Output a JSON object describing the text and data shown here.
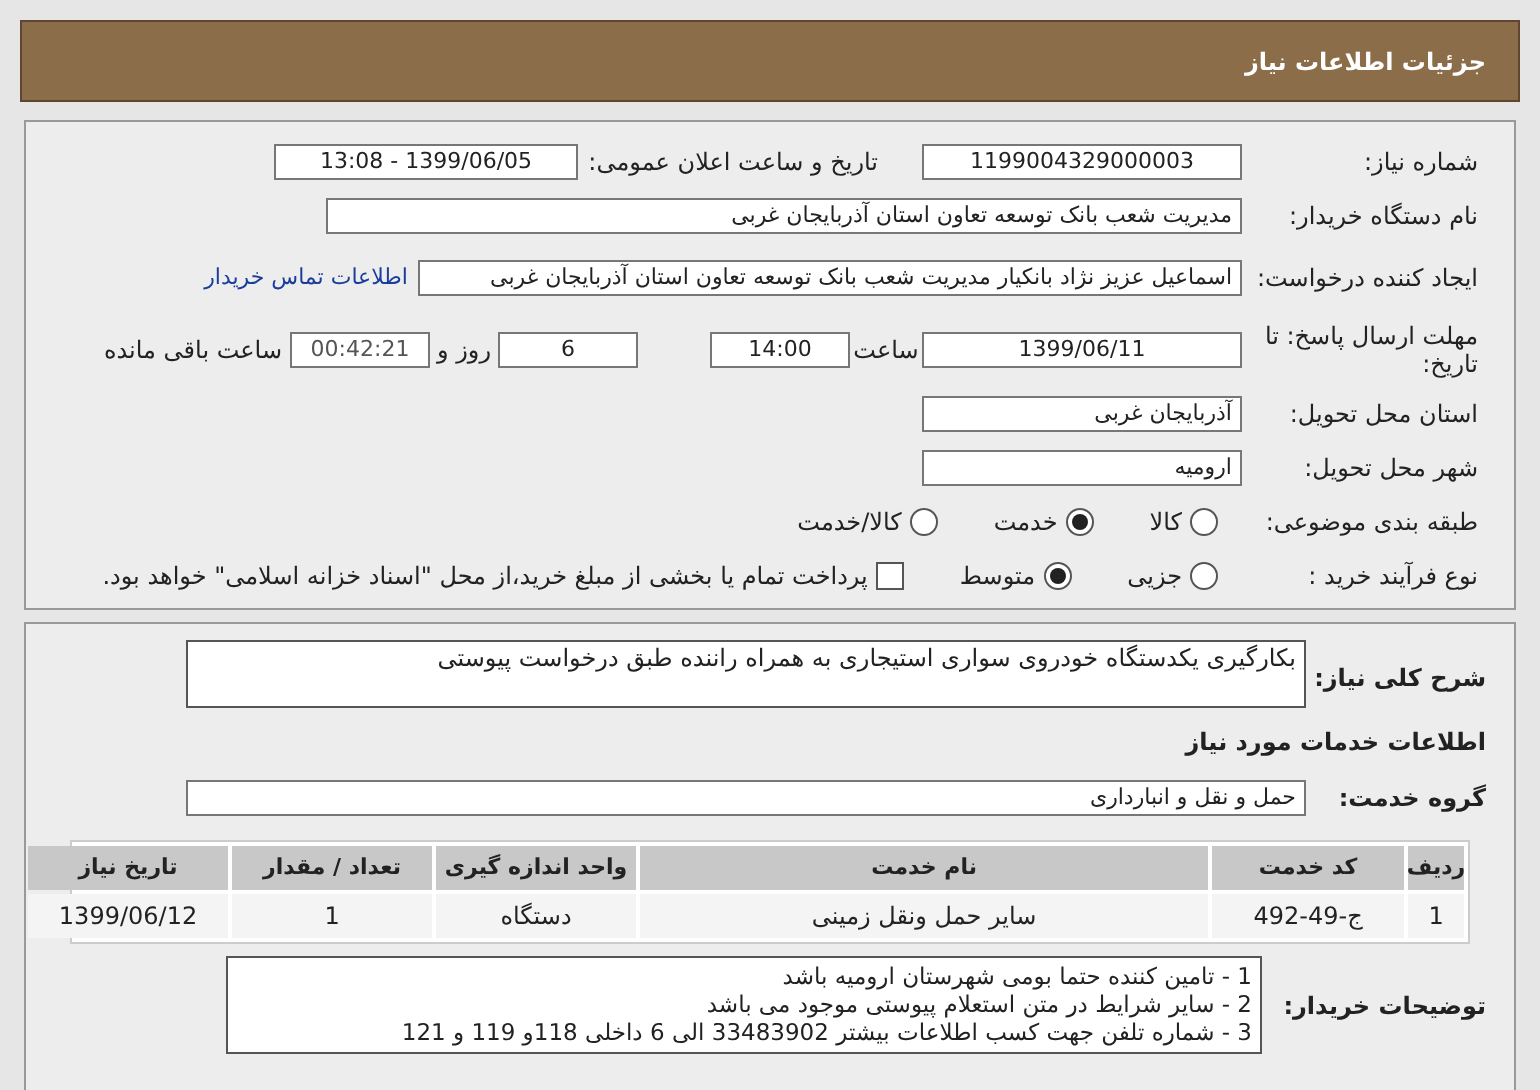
{
  "header": {
    "title": "جزئیات اطلاعات نیاز"
  },
  "need_number": {
    "label": "شماره نیاز:",
    "value": "1199004329000003"
  },
  "announce_date": {
    "label": "تاریخ و ساعت اعلان عمومی:",
    "value": "1399/06/05 - 13:08"
  },
  "buyer_org": {
    "label": "نام دستگاه خریدار:",
    "value": "مدیریت شعب بانک توسعه تعاون استان آذربایجان غربی"
  },
  "creator": {
    "label": "ایجاد کننده درخواست:",
    "value": "اسماعیل عزیز نژاد بانکیار مدیریت شعب بانک توسعه تعاون استان آذربایجان غربی",
    "link": "اطلاعات تماس خریدار"
  },
  "deadline": {
    "label": "مهلت ارسال پاسخ: تا تاریخ:",
    "date": "1399/06/11",
    "time_label": "ساعت",
    "time": "14:00",
    "days": "6",
    "days_label": "روز و",
    "remaining": "00:42:21",
    "remaining_label": "ساعت باقی مانده"
  },
  "province": {
    "label": "استان محل تحویل:",
    "value": "آذربایجان غربی"
  },
  "city": {
    "label": "شهر محل تحویل:",
    "value": "ارومیه"
  },
  "category": {
    "label": "طبقه بندی موضوعی:",
    "options": [
      {
        "label": "کالا",
        "selected": false
      },
      {
        "label": "خدمت",
        "selected": true
      },
      {
        "label": "کالا/خدمت",
        "selected": false
      }
    ]
  },
  "purchase_type": {
    "label": "نوع فرآیند خرید :",
    "options": [
      {
        "label": "جزیی",
        "selected": false
      },
      {
        "label": "متوسط",
        "selected": true
      }
    ],
    "payment": {
      "label": "پرداخت تمام یا بخشی از مبلغ خرید،از محل \"اسناد خزانه اسلامی\" خواهد بود.",
      "checked": false
    }
  },
  "description": {
    "label": "شرح کلی نیاز:",
    "value": "بکارگیری یکدستگاه خودروی سواری استیجاری به همراه راننده طبق درخواست پیوستی"
  },
  "services_heading": "اطلاعات خدمات مورد نیاز",
  "service_group": {
    "label": "گروه خدمت:",
    "value": "حمل و نقل و انبارداری"
  },
  "table": {
    "columns": [
      "ردیف",
      "کد خدمت",
      "نام خدمت",
      "واحد اندازه گیری",
      "تعداد / مقدار",
      "تاریخ نیاز"
    ],
    "rows": [
      [
        "1",
        "ج-49-492",
        "سایر حمل ونقل زمینی",
        "دستگاه",
        "1",
        "1399/06/12"
      ]
    ]
  },
  "buyer_notes": {
    "label": "توضیحات خریدار:",
    "lines": [
      "1 - تامین کننده حتما بومی شهرستان ارومیه باشد",
      "2 - سایر شرایط در متن استعلام پیوستی موجود می باشد",
      "3 - شماره تلفن جهت کسب اطلاعات بیشتر 33483902 الی 6 داخلی 118و 119 و 121"
    ]
  }
}
